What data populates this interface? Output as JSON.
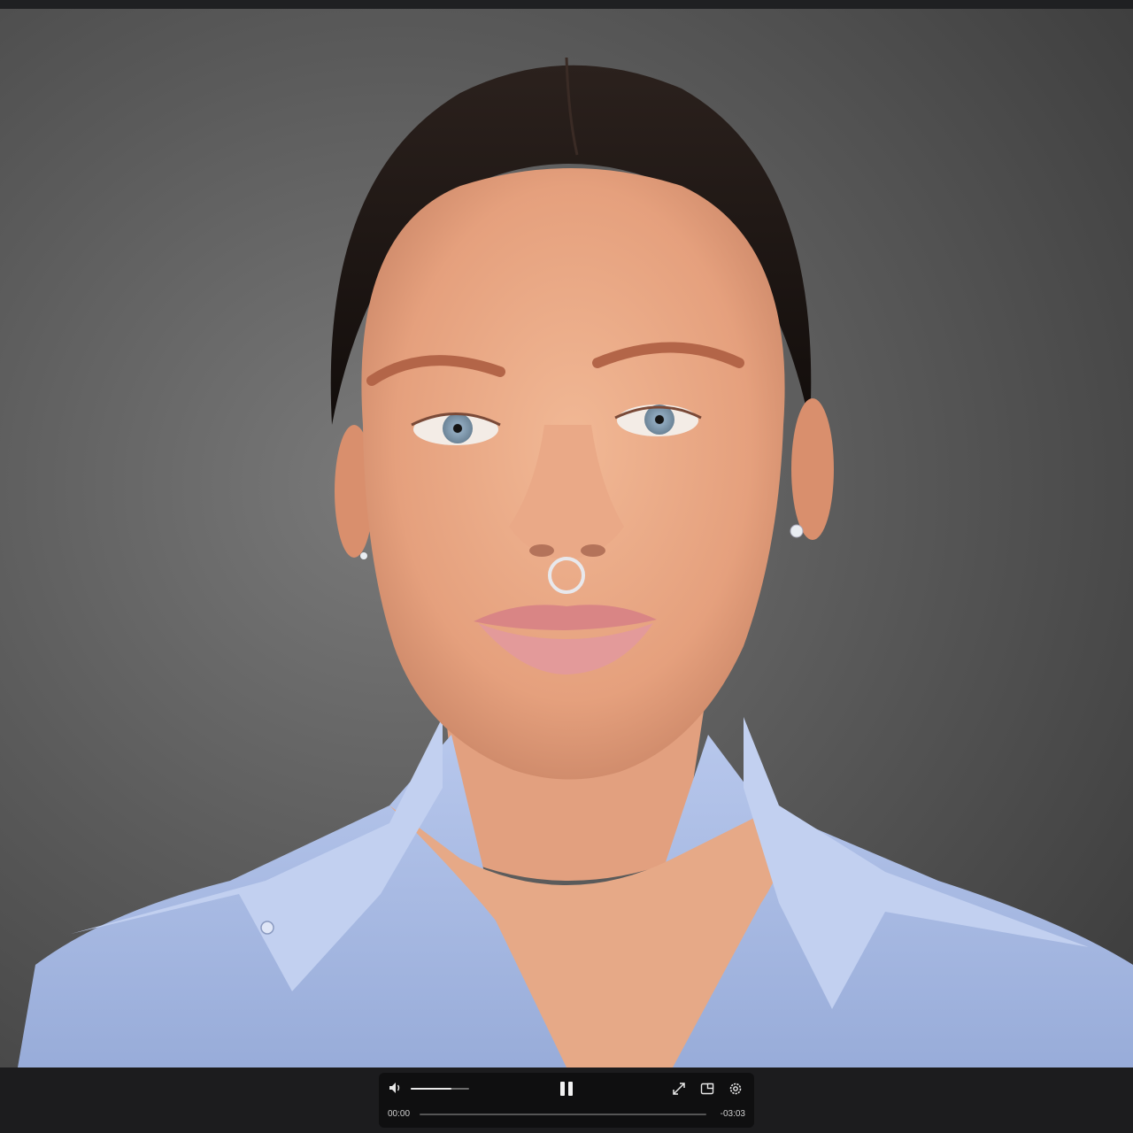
{
  "player": {
    "current_time": "00:00",
    "remaining_time": "-03:03",
    "volume_level": 0.7,
    "progress": 0.0,
    "state": "playing"
  },
  "icons": {
    "volume": "speaker-icon",
    "pause": "pause-icon",
    "fullscreen": "expand-icon",
    "pip": "picture-in-picture-icon",
    "settings": "gear-icon"
  },
  "colors": {
    "background": "#1c1c1e",
    "controls_bg": "#0f0f10",
    "shirt": "#a9bde6",
    "wall": "#5e5e5e"
  }
}
